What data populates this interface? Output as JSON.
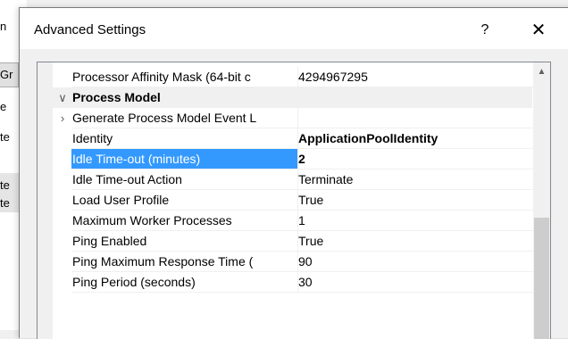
{
  "background_window": {
    "fragments": [
      "n",
      "Gr",
      "e",
      "te",
      "te",
      "te"
    ]
  },
  "dialog": {
    "title": "Advanced Settings",
    "help_label": "?",
    "close_label": "✕"
  },
  "grid": {
    "rows": [
      {
        "name": "Processor Affinity Mask (64-bit c",
        "value": "4294967295",
        "kind": "property"
      },
      {
        "name": "Process Model",
        "value": "",
        "kind": "category",
        "expander": "∨"
      },
      {
        "name": "Generate Process Model Event L",
        "value": "",
        "kind": "property",
        "expander": "›"
      },
      {
        "name": "Identity",
        "value": "ApplicationPoolIdentity",
        "kind": "property",
        "bold_value": true
      },
      {
        "name": "Idle Time-out (minutes)",
        "value": "2",
        "kind": "property",
        "selected": true,
        "bold_value": true
      },
      {
        "name": "Idle Time-out Action",
        "value": "Terminate",
        "kind": "property"
      },
      {
        "name": "Load User Profile",
        "value": "True",
        "kind": "property"
      },
      {
        "name": "Maximum Worker Processes",
        "value": "1",
        "kind": "property"
      },
      {
        "name": "Ping Enabled",
        "value": "True",
        "kind": "property"
      },
      {
        "name": "Ping Maximum Response Time (",
        "value": "90",
        "kind": "property"
      },
      {
        "name": "Ping Period (seconds)",
        "value": "30",
        "kind": "property"
      }
    ]
  },
  "colors": {
    "selection": "#3399ff",
    "category_bg": "#f0f0f0",
    "scroll_thumb": "#cdcdcd"
  }
}
